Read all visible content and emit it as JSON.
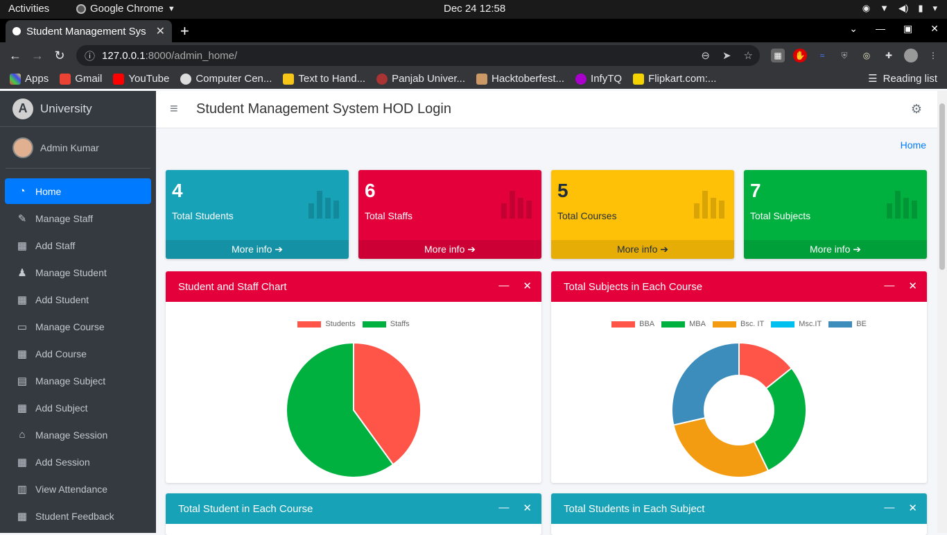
{
  "os": {
    "activities": "Activities",
    "app_name": "Google Chrome",
    "clock": "Dec 24  12:58"
  },
  "browser": {
    "tab_title": "Student Management Sys",
    "url_host": "127.0.0.1",
    "url_path": ":8000/admin_home/",
    "bookmarks": [
      "Apps",
      "Gmail",
      "YouTube",
      "Computer Cen...",
      "Text to Hand...",
      "Panjab Univer...",
      "Hacktoberfest...",
      "InfyTQ",
      "Flipkart.com:..."
    ],
    "reading_list": "Reading list"
  },
  "sidebar": {
    "brand": "University",
    "user": "Admin Kumar",
    "items": [
      {
        "label": "Home",
        "icon": "dashboard-icon"
      },
      {
        "label": "Manage Staff",
        "icon": "user-edit-icon"
      },
      {
        "label": "Add Staff",
        "icon": "grid-icon"
      },
      {
        "label": "Manage Student",
        "icon": "user-graduate-icon"
      },
      {
        "label": "Add Student",
        "icon": "grid-icon"
      },
      {
        "label": "Manage Course",
        "icon": "laptop-icon"
      },
      {
        "label": "Add Course",
        "icon": "grid-icon"
      },
      {
        "label": "Manage Subject",
        "icon": "book-icon"
      },
      {
        "label": "Add Subject",
        "icon": "grid-icon"
      },
      {
        "label": "Manage Session",
        "icon": "graduation-cap-icon"
      },
      {
        "label": "Add Session",
        "icon": "grid-icon"
      },
      {
        "label": "View Attendance",
        "icon": "calendar-icon"
      },
      {
        "label": "Student Feedback",
        "icon": "grid-icon"
      }
    ]
  },
  "header": {
    "title": "Student Management System HOD Login",
    "breadcrumb": "Home"
  },
  "stats": [
    {
      "value": "4",
      "label": "Total Students",
      "more": "More info",
      "color": "#17a2b8"
    },
    {
      "value": "6",
      "label": "Total Staffs",
      "more": "More info",
      "color": "#e4003a"
    },
    {
      "value": "5",
      "label": "Total Courses",
      "more": "More info",
      "color": "#ffc107"
    },
    {
      "value": "7",
      "label": "Total Subjects",
      "more": "More info",
      "color": "#00b140"
    }
  ],
  "cards": [
    {
      "title": "Student and Staff Chart",
      "color": "#e4003a"
    },
    {
      "title": "Total Subjects in Each Course",
      "color": "#e4003a"
    },
    {
      "title": "Total Student in Each Course",
      "color": "#17a2b8"
    },
    {
      "title": "Total Students in Each Subject",
      "color": "#17a2b8"
    }
  ],
  "chart_data": [
    {
      "type": "pie",
      "categories": [
        "Students",
        "Staffs"
      ],
      "values": [
        4,
        6
      ],
      "colors": [
        "#ff5548",
        "#00b140"
      ],
      "legend": "top"
    },
    {
      "type": "pie",
      "variant": "doughnut",
      "categories": [
        "BBA",
        "MBA",
        "Bsc. IT",
        "Msc.IT",
        "BE"
      ],
      "values": [
        1,
        2,
        2,
        0,
        2
      ],
      "colors": [
        "#ff5548",
        "#00b140",
        "#f39c12",
        "#00c0ef",
        "#3c8dbc"
      ],
      "legend": "top"
    }
  ]
}
